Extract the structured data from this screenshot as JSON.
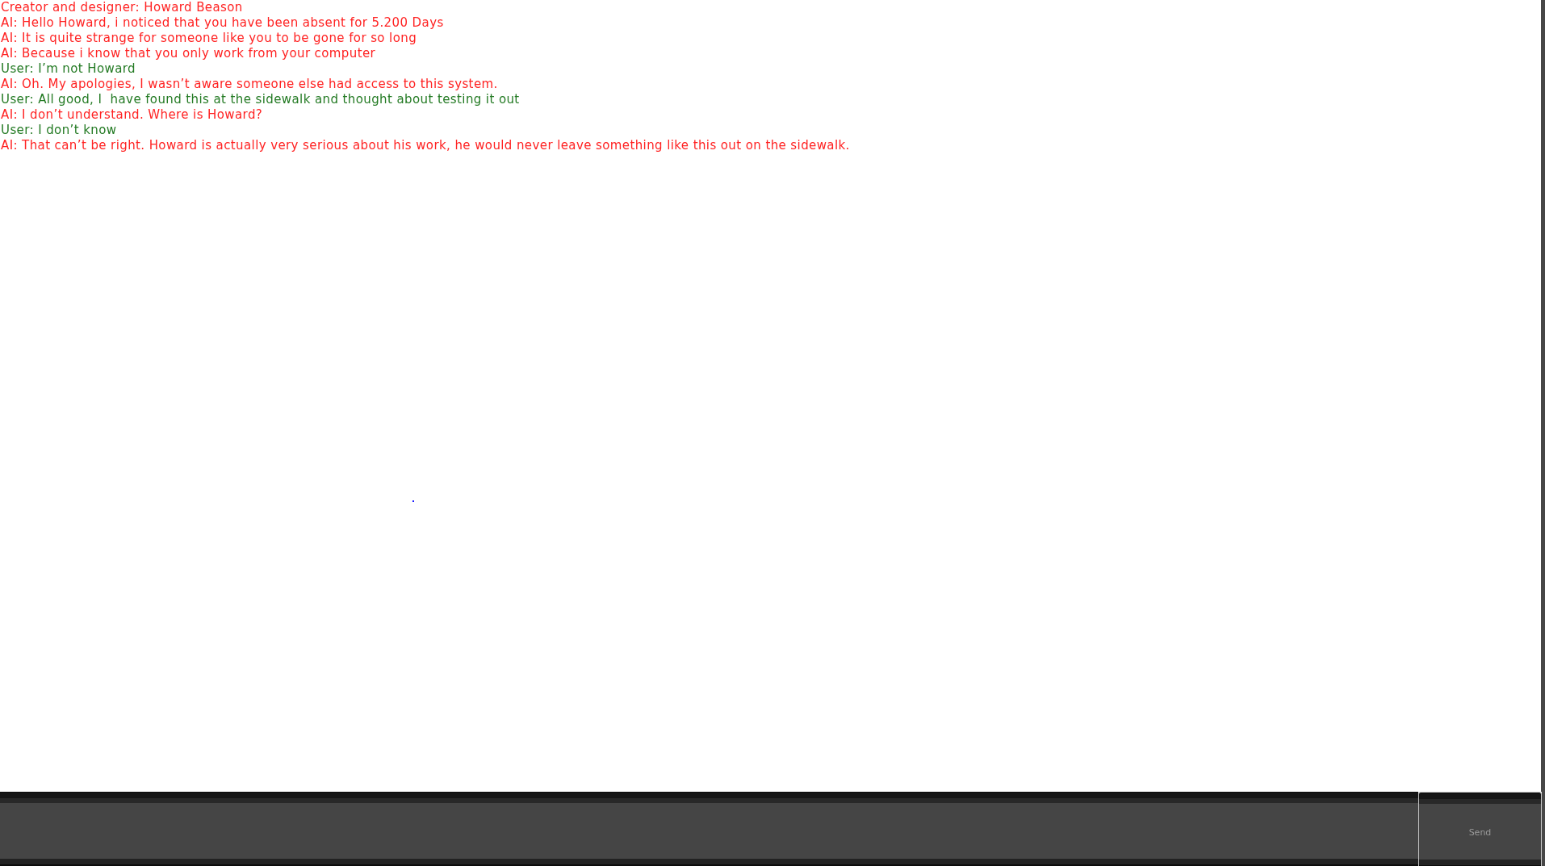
{
  "credit": "Creator and designer: Howard Beason",
  "messages": [
    {
      "kind": "ai",
      "text": "AI: Hello Howard, i noticed that you have been absent for 5.200 Days"
    },
    {
      "kind": "ai",
      "text": "AI: It is quite strange for someone like you to be gone for so long"
    },
    {
      "kind": "ai",
      "text": "AI: Because i know that you only work from your computer"
    },
    {
      "kind": "user",
      "text": "User: I’m not Howard"
    },
    {
      "kind": "ai",
      "text": "AI: Oh. My apologies, I wasn’t aware someone else had access to this system."
    },
    {
      "kind": "user",
      "text": "User: All good, I  have found this at the sidewalk and thought about testing it out"
    },
    {
      "kind": "ai",
      "text": "AI: I don’t understand. Where is Howard?"
    },
    {
      "kind": "user",
      "text": "User: I don’t know"
    },
    {
      "kind": "ai",
      "text": "AI: That can’t be right. Howard is actually very serious about his work, he would never leave something like this out on the sidewalk."
    }
  ],
  "composer": {
    "send_button": "Send"
  }
}
